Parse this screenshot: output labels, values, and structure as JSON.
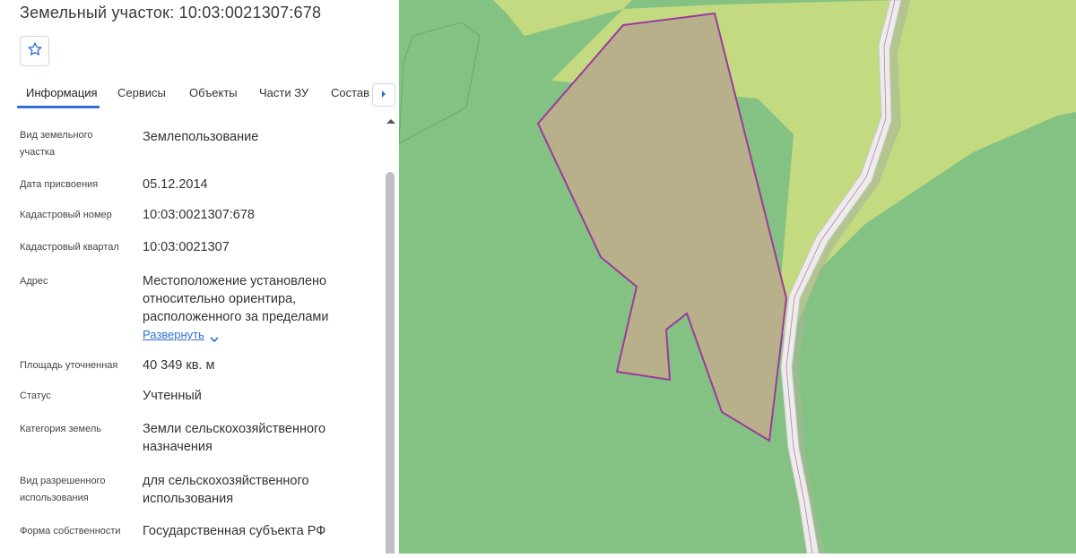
{
  "title": "Земельный участок: 10:03:0021307:678",
  "favorite_icon": "star-outline-icon",
  "tabs": [
    {
      "label": "Информация",
      "active": true
    },
    {
      "label": "Сервисы"
    },
    {
      "label": "Объекты"
    },
    {
      "label": "Части ЗУ"
    },
    {
      "label": "Состав"
    }
  ],
  "rows": [
    {
      "label": "Вид земельного участка",
      "value": "Землепользование"
    },
    {
      "label": "Дата присвоения",
      "value": "05.12.2014"
    },
    {
      "label": "Кадастровый номер",
      "value": "10:03:0021307:678"
    },
    {
      "label": "Кадастровый квартал",
      "value": "10:03:0021307"
    },
    {
      "label": "Адрес",
      "value": "Местоположение установлено относительно ориентира, расположенного за пределами"
    },
    {
      "label": "Площадь уточненная",
      "value": "40 349 кв. м"
    },
    {
      "label": "Статус",
      "value": "Учтенный"
    },
    {
      "label": "Категория земель",
      "value": "Земли сельскохозяйственного назначения"
    },
    {
      "label": "Вид разрешенного использования",
      "value": "для сельскохозяйственного использования"
    },
    {
      "label": "Форма собственности",
      "value": "Государственная субъекта РФ"
    }
  ],
  "expand_label": "Развернуть",
  "colors": {
    "accent": "#2f6fd6",
    "forest": "#84c283",
    "field": "#c4da80",
    "parcel_fill": "#b7b08a",
    "parcel_stroke": "#9b3a9e",
    "road": "#e8e8e8"
  }
}
